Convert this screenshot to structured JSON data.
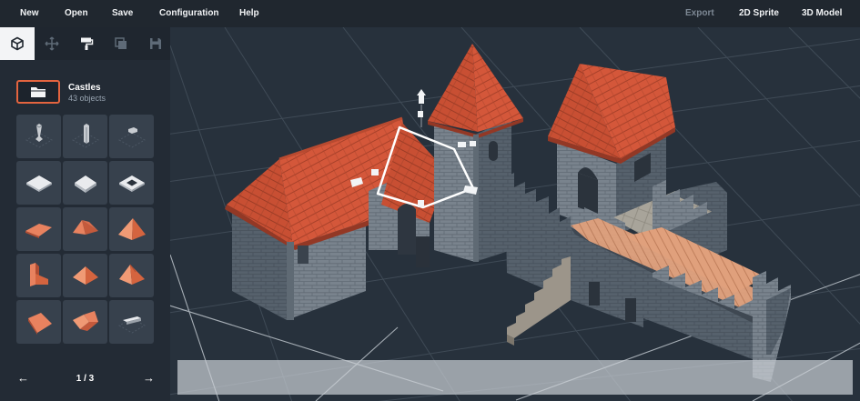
{
  "menu": {
    "new": "New",
    "open": "Open",
    "save": "Save",
    "configuration": "Configuration",
    "help": "Help",
    "export": "Export",
    "sprite_2d": "2D Sprite",
    "model_3d": "3D Model"
  },
  "tools": [
    "cube-icon",
    "move-icon",
    "paint-roller-icon",
    "duplicate-icon",
    "save-disk-icon"
  ],
  "category": {
    "title": "Castles",
    "count": "43 objects"
  },
  "palette": [
    "wall-post-icon",
    "wall-post-icon",
    "wall-post-icon",
    "floor-tile-icon",
    "floor-tile-icon",
    "floor-hole-icon",
    "roof-slope-icon",
    "roof-pyramid-icon",
    "roof-pyramid-icon",
    "roof-gable-icon",
    "roof-pyramid-icon",
    "roof-pyramid-icon",
    "roof-block-icon",
    "roof-corner-icon",
    "beam-icon"
  ],
  "pager": {
    "label": "1 / 3",
    "prev": "←",
    "next": "→"
  },
  "colors": {
    "accent": "#e4643f",
    "roof": "#d4573a",
    "stone": "#6f7a84",
    "viewport": "#27313c"
  }
}
